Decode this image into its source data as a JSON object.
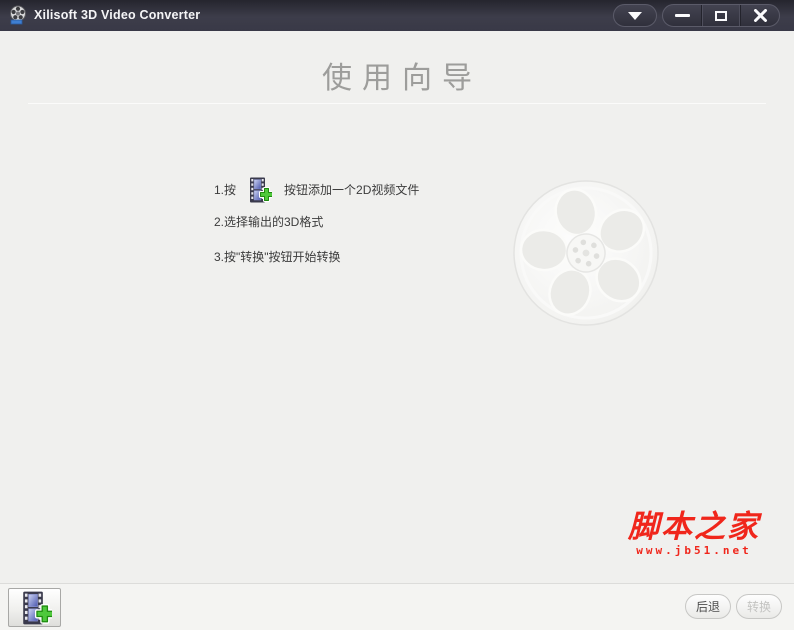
{
  "titlebar": {
    "app_title": "Xilisoft 3D Video Converter",
    "app_icon": "film-reel-icon",
    "controls": [
      "menu",
      "minimize",
      "maximize",
      "close"
    ]
  },
  "wizard": {
    "title": "使用向导",
    "steps": {
      "step1_prefix": "1.按",
      "step1_icon": "add-video-filmstrip-icon",
      "step1_suffix": "按钮添加一个2D视频文件",
      "step2": "2.选择输出的3D格式",
      "step3": "3.按\"转换\"按钮开始转换"
    },
    "background_watermark": "film-reel"
  },
  "site_watermark": {
    "name": "脚本之家",
    "url": "www.jb51.net"
  },
  "footer": {
    "add_video_icon": "add-video-filmstrip-icon",
    "back_label": "后退",
    "convert_label": "转换",
    "convert_enabled": false
  },
  "colors": {
    "titlebar_bg": "#3a3a47",
    "content_bg": "#f0f0ee",
    "title_text": "#9d9d9b",
    "body_text": "#3c3c3c",
    "watermark_red": "#f0261b",
    "plus_green": "#4ec93b",
    "frame_blue": "#5560b8"
  }
}
